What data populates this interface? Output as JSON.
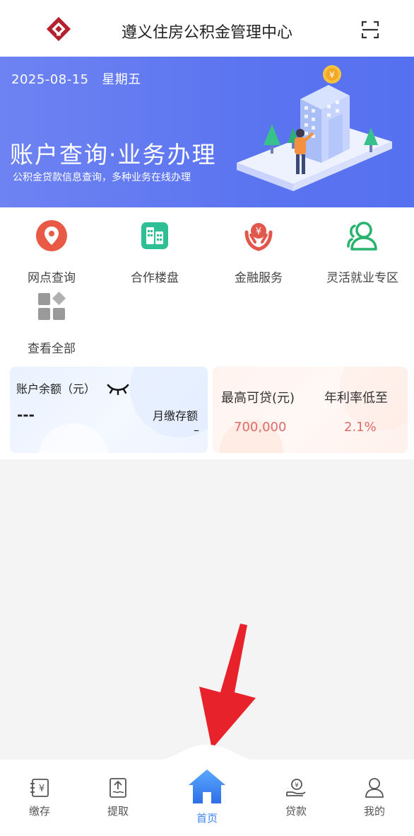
{
  "header": {
    "title": "遵义住房公积金管理中心",
    "logo_icon": "diamond-logo-icon",
    "scan_icon": "scan-icon"
  },
  "banner": {
    "date": "2025-08-15",
    "weekday": "星期五",
    "headline": "账户查询·业务办理",
    "subline": "公积金贷款信息查询，多种业务在线办理"
  },
  "menu": {
    "items": [
      {
        "label": "网点查询",
        "icon": "location-pin-icon",
        "color": "#e95a46"
      },
      {
        "label": "合作楼盘",
        "icon": "building-icon",
        "color": "#2fbf94"
      },
      {
        "label": "金融服务",
        "icon": "yuan-hands-icon",
        "color": "#e2574c"
      },
      {
        "label": "灵活就业专区",
        "icon": "users-icon",
        "color": "#26b36b"
      },
      {
        "label": "查看全部",
        "icon": "grid-all-icon",
        "color": "#8e8e8e"
      }
    ]
  },
  "account": {
    "balance_label": "账户余额（元）",
    "balance_value": "---",
    "monthly_label": "月缴存额",
    "monthly_value": "–"
  },
  "loan": {
    "max_label": "最高可贷(元)",
    "max_value": "700,000",
    "rate_label": "年利率低至",
    "rate_value": "2.1%",
    "value_color": "#e06a6a"
  },
  "tabbar": {
    "items": [
      {
        "label": "缴存",
        "icon": "deposit-yuan-icon"
      },
      {
        "label": "提取",
        "icon": "withdraw-upload-icon"
      },
      {
        "label": "首页",
        "icon": "home-icon",
        "active": true
      },
      {
        "label": "贷款",
        "icon": "loan-hand-icon"
      },
      {
        "label": "我的",
        "icon": "person-icon"
      }
    ],
    "active_color": "#3d86f0"
  },
  "annotation": {
    "arrow_color": "#e8222a"
  }
}
